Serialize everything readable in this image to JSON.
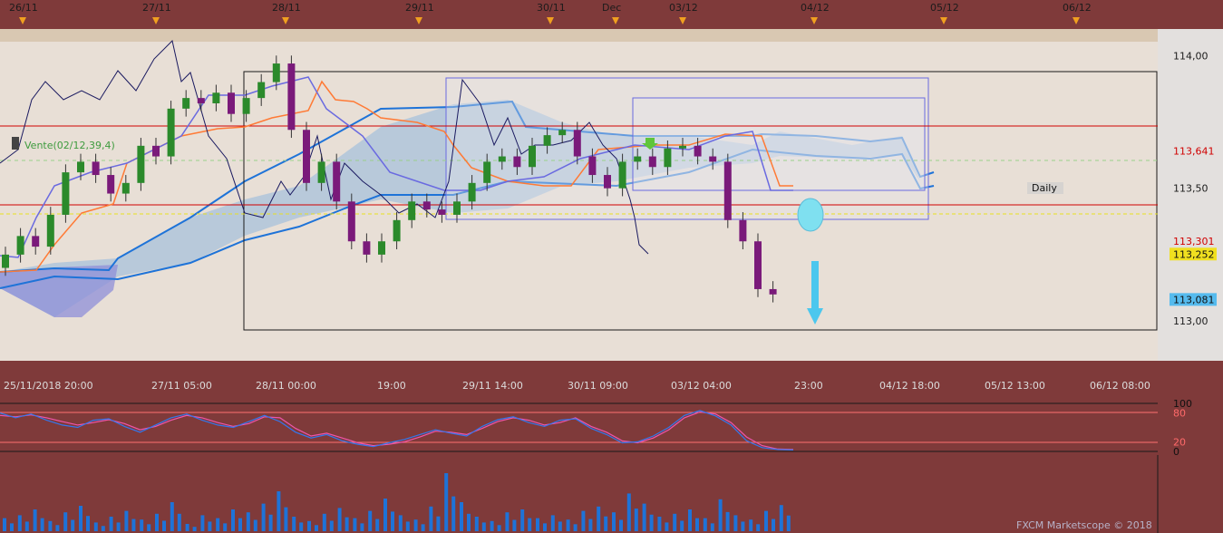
{
  "chart_data": [
    {
      "type": "candlestick",
      "title": "Daily",
      "signal_label": "Vente(02/12,39,4)",
      "top_date_markers": [
        "26/11",
        "27/11",
        "28/11",
        "29/11",
        "30/11",
        "Dec",
        "03/12",
        "04/12",
        "05/12",
        "06/12"
      ],
      "x_time_labels": [
        "25/11/2018 20:00",
        "27/11 05:00",
        "28/11 00:00",
        "19:00",
        "29/11 14:00",
        "30/11 09:00",
        "03/12 04:00",
        "23:00",
        "04/12 18:00",
        "05/12 13:00",
        "06/12 08:00"
      ],
      "y_ticks": [
        "114,00",
        "113,50",
        "113,00"
      ],
      "ylim": [
        112.85,
        114.1
      ],
      "price_tags": [
        {
          "label": "113,641",
          "value": 113.641,
          "color": "#d00000"
        },
        {
          "label": "113,301",
          "value": 113.301,
          "color": "#d00000"
        },
        {
          "label": "113,252",
          "value": 113.252,
          "color": "#f0e020"
        },
        {
          "label": "113,081",
          "value": 113.081,
          "color": "#55bbee"
        }
      ],
      "candles_close_approx": [
        113.25,
        113.32,
        113.28,
        113.4,
        113.56,
        113.6,
        113.55,
        113.48,
        113.52,
        113.66,
        113.62,
        113.8,
        113.84,
        113.82,
        113.86,
        113.78,
        113.84,
        113.9,
        113.97,
        113.72,
        113.52,
        113.6,
        113.45,
        113.3,
        113.25,
        113.3,
        113.38,
        113.45,
        113.42,
        113.4,
        113.45,
        113.52,
        113.6,
        113.62,
        113.58,
        113.66,
        113.7,
        113.72,
        113.62,
        113.55,
        113.5,
        113.6,
        113.62,
        113.58,
        113.65,
        113.66,
        113.62,
        113.6,
        113.38,
        113.3,
        113.12,
        113.1
      ]
    },
    {
      "type": "line",
      "title": "",
      "y_ticks": [
        "100",
        "80",
        "20",
        "0"
      ],
      "ylim": [
        0,
        100
      ],
      "series": [
        {
          "values": [
            75,
            72,
            76,
            70,
            62,
            55,
            60,
            66,
            58,
            45,
            52,
            65,
            75,
            70,
            60,
            52,
            58,
            72,
            70,
            48,
            32,
            38,
            28,
            18,
            12,
            15,
            20,
            30,
            42,
            40,
            35,
            48,
            62,
            70,
            65,
            55,
            60,
            70,
            52,
            40,
            22,
            18,
            28,
            45,
            70,
            82,
            78,
            60,
            30,
            12,
            5,
            4
          ],
          "color": "#ee55aa"
        },
        {
          "values": [
            80,
            70,
            78,
            65,
            55,
            50,
            65,
            68,
            52,
            40,
            55,
            70,
            78,
            65,
            55,
            50,
            62,
            75,
            62,
            40,
            28,
            35,
            22,
            15,
            10,
            18,
            25,
            35,
            45,
            38,
            32,
            52,
            66,
            72,
            60,
            52,
            65,
            68,
            48,
            35,
            18,
            20,
            32,
            50,
            75,
            85,
            74,
            55,
            22,
            8,
            4,
            3
          ],
          "color": "#3377ee"
        }
      ]
    },
    {
      "type": "bar",
      "title": "",
      "values": [
        18,
        22,
        30,
        14,
        26,
        35,
        12,
        20,
        28,
        16,
        24,
        40,
        10,
        22,
        18,
        30,
        26,
        38,
        55,
        20,
        14,
        24,
        32,
        18,
        28,
        45,
        22,
        16,
        34,
        80,
        40,
        20,
        14,
        26,
        30,
        18,
        22,
        16,
        28,
        34,
        26,
        52,
        38,
        20,
        24,
        30,
        18,
        44,
        22,
        16,
        28,
        36
      ]
    }
  ],
  "watermark": "FXCM Marketscope © 2018"
}
